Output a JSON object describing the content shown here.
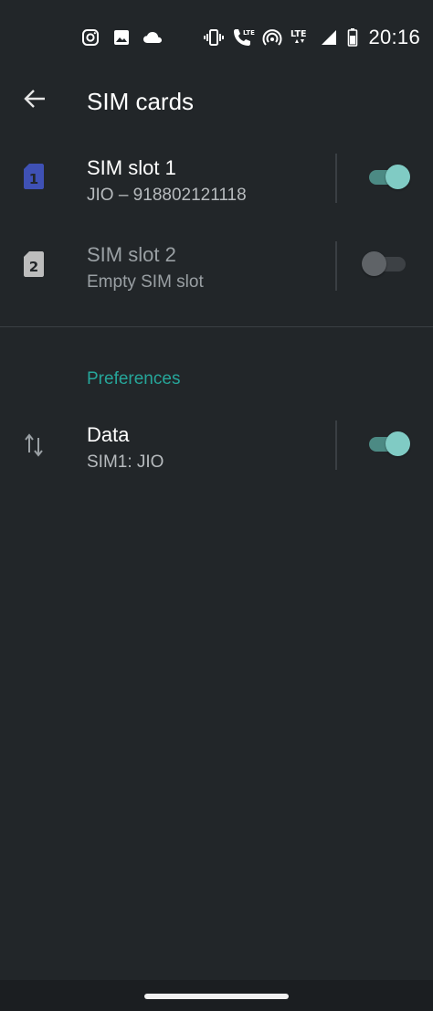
{
  "status_bar": {
    "time": "20:16",
    "left_icons": [
      "instagram-icon",
      "image-icon",
      "cloud-icon"
    ],
    "right_icons": [
      "vibrate-icon",
      "volte-call-icon",
      "hotspot-icon",
      "lte-icon",
      "signal-icon",
      "battery-icon"
    ],
    "lte_label": "LTE"
  },
  "app_bar": {
    "title": "SIM cards"
  },
  "sims": [
    {
      "slot_number": "1",
      "title": "SIM slot 1",
      "subtitle": "JIO – 918802121118",
      "enabled": true,
      "icon_color": "#3f51b5"
    },
    {
      "slot_number": "2",
      "title": "SIM slot 2",
      "subtitle": "Empty SIM slot",
      "enabled": false,
      "icon_color": "#bdbdbd"
    }
  ],
  "preferences": {
    "header": "Preferences",
    "data": {
      "title": "Data",
      "subtitle": "SIM1: JIO",
      "enabled": true
    }
  },
  "colors": {
    "background": "#222629",
    "accent": "#26a69a",
    "switch_on_thumb": "#80cbc4",
    "switch_on_track": "#4c8a84"
  }
}
